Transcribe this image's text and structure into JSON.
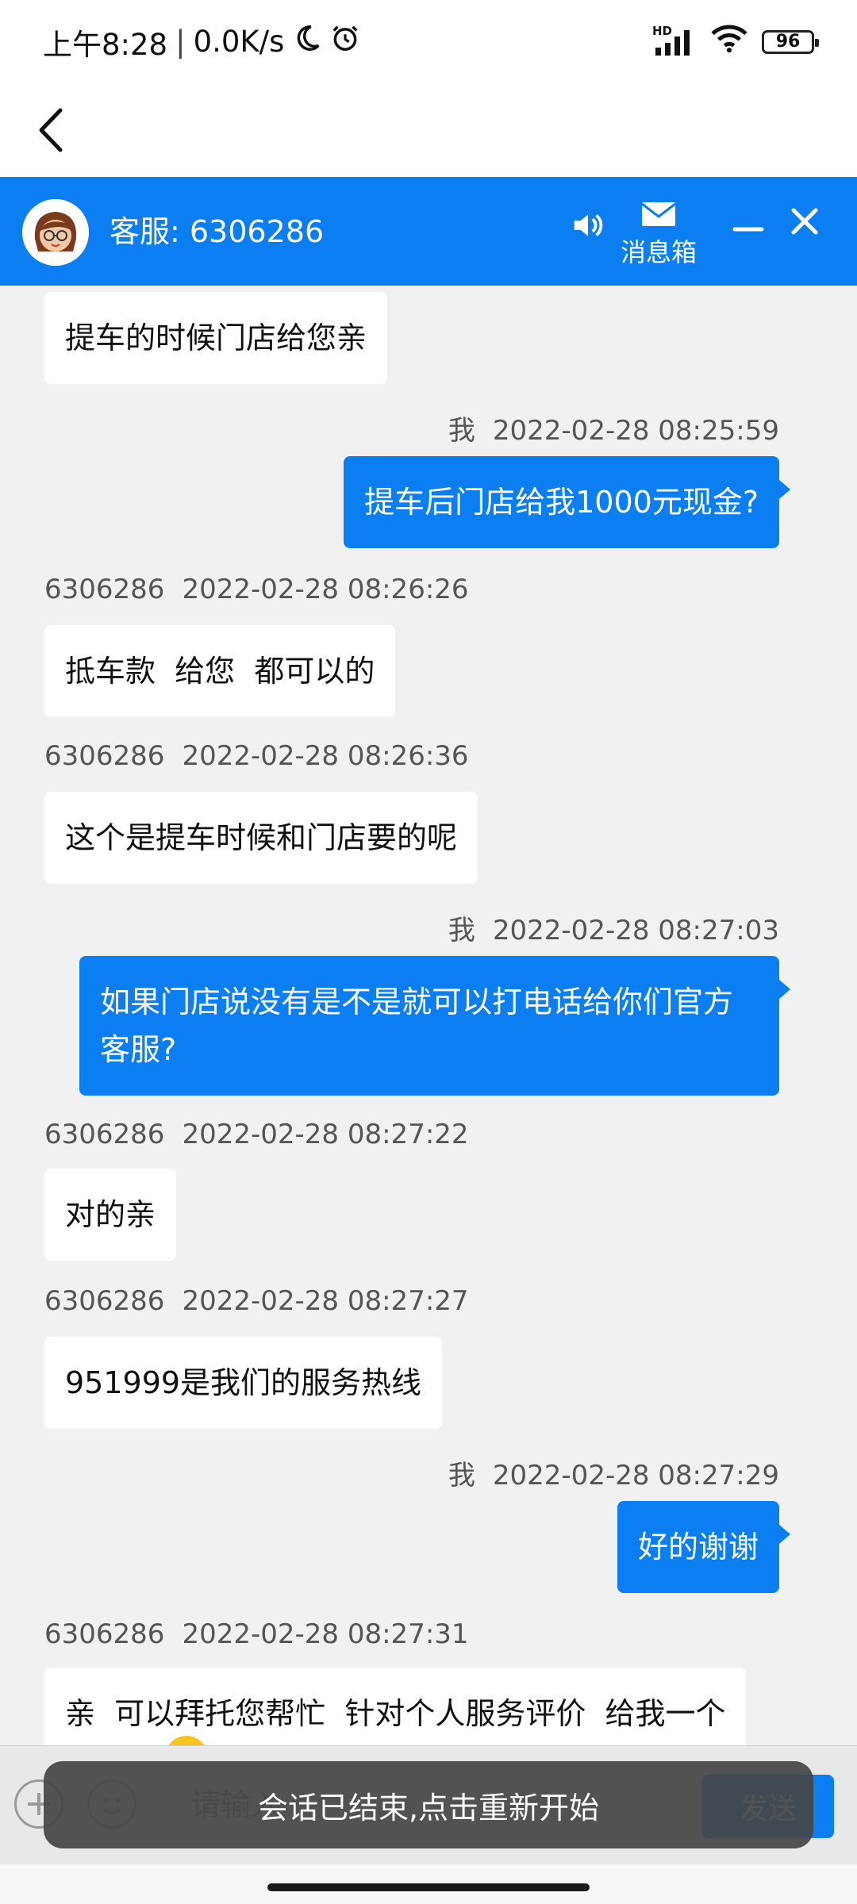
{
  "status_bar": {
    "time": "上午8:28",
    "speed": "0.0K/s",
    "signal_label": "HD",
    "battery": "96"
  },
  "header": {
    "title": "客服: 6306286",
    "mailbox_label": "消息箱"
  },
  "messages": [
    {
      "dir": "in",
      "sender": "",
      "time": "",
      "text": "提车的时候门店给您亲"
    },
    {
      "dir": "out",
      "sender": "我",
      "time": "2022-02-28 08:25:59",
      "text": "提车后门店给我1000元现金?"
    },
    {
      "dir": "in",
      "sender": "6306286",
      "time": "2022-02-28 08:26:26",
      "text": "抵车款  给您  都可以的"
    },
    {
      "dir": "in",
      "sender": "6306286",
      "time": "2022-02-28 08:26:36",
      "text": "这个是提车时候和门店要的呢"
    },
    {
      "dir": "out",
      "sender": "我",
      "time": "2022-02-28 08:27:03",
      "text": "如果门店说没有是不是就可以打电话给你们官方客服?"
    },
    {
      "dir": "in",
      "sender": "6306286",
      "time": "2022-02-28 08:27:22",
      "text": "对的亲"
    },
    {
      "dir": "in",
      "sender": "6306286",
      "time": "2022-02-28 08:27:27",
      "text": "951999是我们的服务热线"
    },
    {
      "dir": "out",
      "sender": "我",
      "time": "2022-02-28 08:27:29",
      "text": "好的谢谢"
    },
    {
      "dir": "in",
      "sender": "6306286",
      "time": "2022-02-28 08:27:31",
      "text": "亲  可以拜托您帮忙  针对个人服务评价  给我一个"
    }
  ],
  "input": {
    "placeholder": "请输入",
    "send_label": "发送"
  },
  "toast": {
    "text": "会话已结束,点击重新开始"
  },
  "colors": {
    "brand": "#0b7ef2",
    "incoming_bubble": "#ffffff",
    "background": "#f1f1f1"
  }
}
